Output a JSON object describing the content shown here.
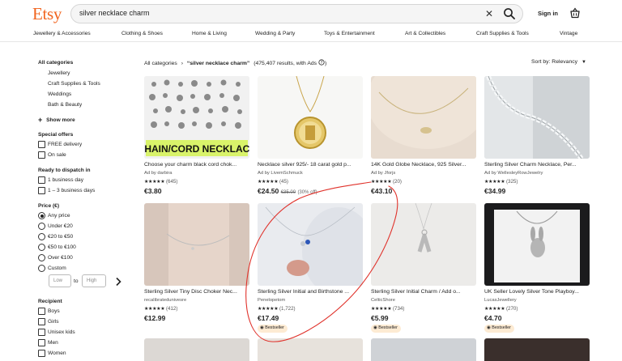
{
  "header": {
    "logo": "Etsy",
    "search_value": "silver necklace charm",
    "sign_in": "Sign in"
  },
  "categories": [
    "Jewellery & Accessories",
    "Clothing & Shoes",
    "Home & Living",
    "Wedding & Party",
    "Toys & Entertainment",
    "Art & Collectibles",
    "Craft Supplies & Tools",
    "Vintage"
  ],
  "sidebar": {
    "all_categories": "All categories",
    "cat_items": [
      "Jewellery",
      "Craft Supplies & Tools",
      "Weddings",
      "Bath & Beauty"
    ],
    "show_more": "Show more",
    "special_offers": "Special offers",
    "offers": [
      "FREE delivery",
      "On sale"
    ],
    "dispatch": "Ready to dispatch in",
    "dispatch_items": [
      "1 business day",
      "1 – 3 business days"
    ],
    "price_title": "Price (€)",
    "price_options": [
      "Any price",
      "Under €20",
      "€20 to €50",
      "€50 to €100",
      "Over €100",
      "Custom"
    ],
    "low_placeholder": "Low",
    "to": "to",
    "high_placeholder": "High",
    "recipient": "Recipient",
    "recipient_items": [
      "Boys",
      "Girls",
      "Unisex kids",
      "Men",
      "Women"
    ]
  },
  "results": {
    "all_categories": "All categories",
    "sep": "›",
    "query": "“silver necklace charm”",
    "count": "(475,407 results, with Ads",
    "sort": "Sort by: Relevancy"
  },
  "listings": [
    {
      "title": "Choose your charm black cord chok...",
      "sub": "Ad by darbira",
      "stars": "★★★★★",
      "count": "(645)",
      "price": "€3.80",
      "orig": "",
      "disc": "",
      "badge": "",
      "overlay": "CHAIN/CORD NECKLACE"
    },
    {
      "title": "Necklace silver 925/- 18 carat gold p...",
      "sub": "Ad by LivemSchmuck",
      "stars": "★★★★★",
      "count": "(45)",
      "price": "€24.50",
      "orig": "€35.00",
      "disc": "(30% off)",
      "badge": "",
      "overlay": ""
    },
    {
      "title": "14K Gold Globe Necklace, 925 Silver...",
      "sub": "Ad by Jforjs",
      "stars": "★★★★★",
      "count": "(20)",
      "price": "€43.10",
      "orig": "",
      "disc": "",
      "badge": "",
      "overlay": ""
    },
    {
      "title": "Sterling Silver Charm Necklace, Per...",
      "sub": "Ad by WellesleyRowJewelry",
      "stars": "★★★★★",
      "count": "(325)",
      "price": "€34.99",
      "orig": "",
      "disc": "",
      "badge": "",
      "overlay": ""
    },
    {
      "title": "Sterling Silver Tiny Disc Choker Nec...",
      "sub": "recalibratedunivesre",
      "stars": "★★★★★",
      "count": "(412)",
      "price": "€12.99",
      "orig": "",
      "disc": "",
      "badge": "",
      "overlay": ""
    },
    {
      "title": "Sterling Silver Initial and Birthstone ...",
      "sub": "Penelopetom",
      "stars": "★★★★★",
      "count": "(1,722)",
      "price": "€17.49",
      "orig": "",
      "disc": "",
      "badge": "Bestseller",
      "overlay": ""
    },
    {
      "title": "Sterling Silver Initial Charm / Add o...",
      "sub": "CelticShore",
      "stars": "★★★★★",
      "count": "(734)",
      "price": "€5.99",
      "orig": "",
      "disc": "",
      "badge": "Bestseller",
      "overlay": ""
    },
    {
      "title": "UK Seller Lovely Silver Tone Playboy...",
      "sub": "LucasJewellery",
      "stars": "★★★★★",
      "count": "(270)",
      "price": "€4.70",
      "orig": "",
      "disc": "",
      "badge": "Bestseller",
      "overlay": ""
    }
  ],
  "icons": {
    "search": "search-icon",
    "clear": "close-icon",
    "basket": "basket-icon",
    "plus": "plus-icon",
    "chevron": "chevron-right-icon",
    "caret": "caret-down-icon",
    "info": "info-icon"
  },
  "colors": {
    "brand": "#f1641e",
    "badge_bg": "#fdebd3",
    "annotation": "#e0322b"
  }
}
